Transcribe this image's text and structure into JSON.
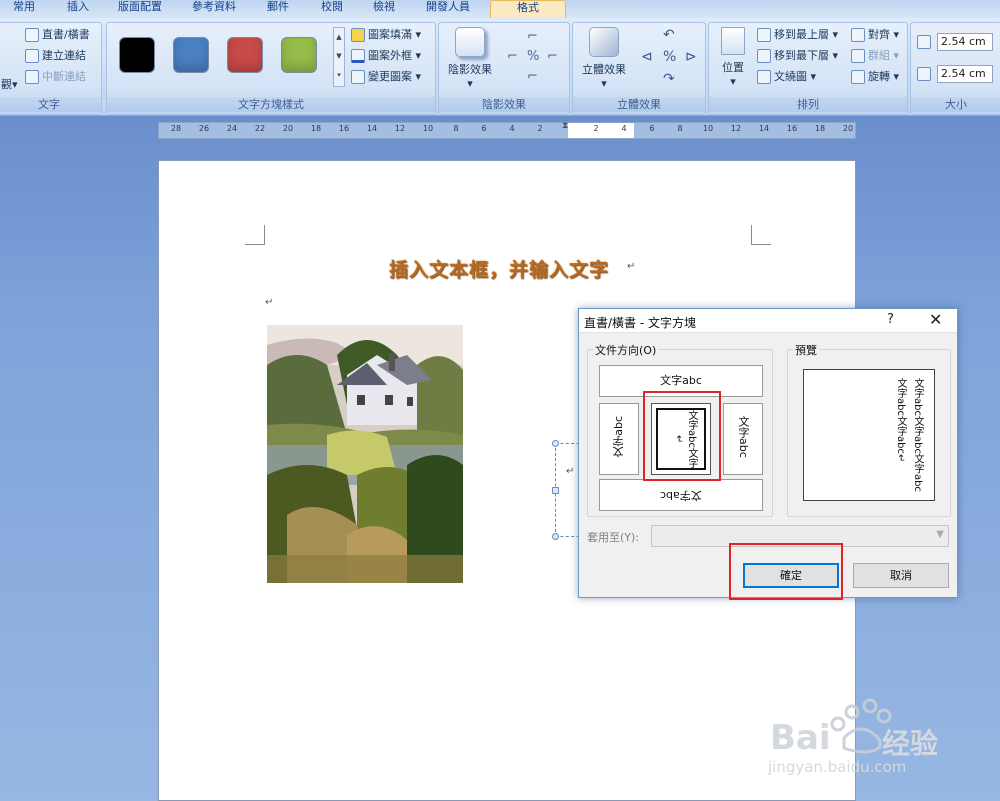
{
  "ribbon": {
    "tabs": [
      "常用",
      "插入",
      "版面配置",
      "參考資料",
      "郵件",
      "校閱",
      "檢視",
      "開發人員",
      "格式"
    ],
    "active_tab": "格式",
    "groups": {
      "text": {
        "label": "文字",
        "items": [
          "直書/橫書",
          "建立連結",
          "中斷連結"
        ],
        "partial_left": "觀"
      },
      "textbox_styles": {
        "label": "文字方塊樣式",
        "swatches": [
          "#000000",
          "#4a81c2",
          "#c84a49",
          "#96bc4a"
        ],
        "items": [
          "圖案填滿",
          "圖案外框",
          "變更圖案"
        ]
      },
      "shadow": {
        "label": "陰影效果",
        "button": "陰影效果"
      },
      "threed": {
        "label": "立體效果",
        "button": "立體效果"
      },
      "arrange": {
        "label": "排列",
        "position_button": "位置",
        "items": [
          "移到最上層",
          "移到最下層",
          "文繞圖",
          "對齊",
          "群組",
          "旋轉"
        ]
      },
      "size": {
        "label": "大小",
        "height": "2.54 cm",
        "width": "2.54 cm"
      }
    }
  },
  "ruler": {
    "numbers": [
      "28",
      "26",
      "24",
      "22",
      "20",
      "18",
      "16",
      "14",
      "12",
      "10",
      "8",
      "6",
      "4",
      "2",
      "2",
      "4",
      "6",
      "8",
      "10",
      "12",
      "14",
      "16",
      "18",
      "20"
    ]
  },
  "document": {
    "title": "插入文本框，并输入文字",
    "pilcrow": "↵"
  },
  "dialog": {
    "title": "直書/橫書 - 文字方塊",
    "help": "?",
    "close": "✕",
    "orientation_label": "文件方向(O)",
    "orientation_options": {
      "top": "文字abc",
      "left": "文字abc",
      "center": "文字abc文字↵",
      "right": "文字abc",
      "bottom": "文字abc"
    },
    "preview_label": "預覽",
    "preview_text": "文字abc文字abc文字abc文字abc文字abc↵",
    "apply_to_label": "套用至(Y):",
    "ok": "確定",
    "cancel": "取消"
  },
  "watermark": {
    "brand": "Bai",
    "brand_cn": "经验",
    "url": "jingyan.baidu.com"
  }
}
